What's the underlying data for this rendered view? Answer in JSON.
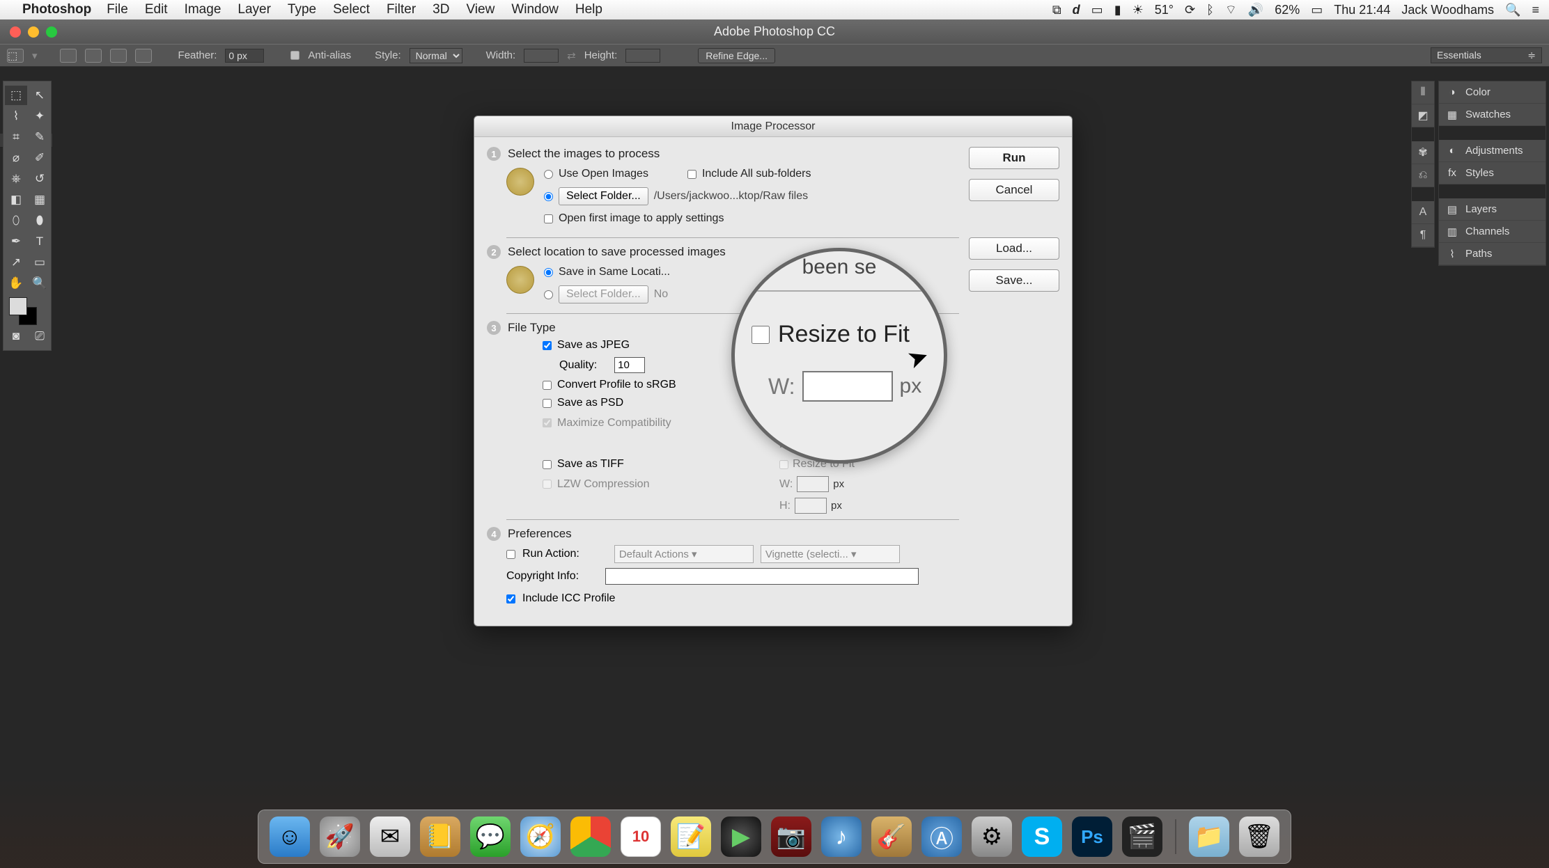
{
  "menubar": {
    "app": "Photoshop",
    "items": [
      "File",
      "Edit",
      "Image",
      "Layer",
      "Type",
      "Select",
      "Filter",
      "3D",
      "View",
      "Window",
      "Help"
    ],
    "right": {
      "temp": "51°",
      "battery": "62%",
      "clock": "Thu 21:44",
      "user": "Jack Woodhams"
    }
  },
  "window": {
    "title": "Adobe Photoshop CC"
  },
  "optbar": {
    "feather_label": "Feather:",
    "feather": "0 px",
    "aa": "Anti-alias",
    "style_label": "Style:",
    "style": "Normal",
    "width_label": "Width:",
    "height_label": "Height:",
    "refine": "Refine Edge...",
    "workspace": "Essentials"
  },
  "panels": {
    "right": [
      "Color",
      "Swatches",
      "Adjustments",
      "Styles",
      "Layers",
      "Channels",
      "Paths"
    ]
  },
  "dialog": {
    "title": "Image Processor",
    "buttons": {
      "run": "Run",
      "cancel": "Cancel",
      "load": "Load...",
      "save": "Save..."
    },
    "s1": {
      "heading": "Select the images to process",
      "use_open": "Use Open Images",
      "include_sub": "Include All sub-folders",
      "select_folder": "Select Folder...",
      "path": "/Users/jackwoo...ktop/Raw files",
      "open_first": "Open first image to apply settings"
    },
    "s2": {
      "heading": "Select location to save processed images",
      "same_loc": "Save in Same Locati...",
      "select_folder": "Select Folder...",
      "no_folder": "No"
    },
    "s3": {
      "heading": "File Type",
      "jpeg": "Save as JPEG",
      "quality_label": "Quality:",
      "quality": "10",
      "convert": "Convert Profile to sRGB",
      "resize": "Resize to Fit",
      "psd": "Save as PSD",
      "maxcompat": "Maximize Compatibility",
      "tiff": "Save as TIFF",
      "lzw": "LZW Compression",
      "w": "W:",
      "h": "H:",
      "px": "px"
    },
    "s4": {
      "heading": "Preferences",
      "run_action": "Run Action:",
      "action_set": "Default Actions",
      "action": "Vignette (selecti...",
      "copyright": "Copyright Info:",
      "icc": "Include ICC Profile"
    }
  },
  "magnifier": {
    "top_text": "been se",
    "resize": "Resize to Fit",
    "w": "W:",
    "px": "px"
  },
  "dock": {
    "cal_day": "10"
  }
}
